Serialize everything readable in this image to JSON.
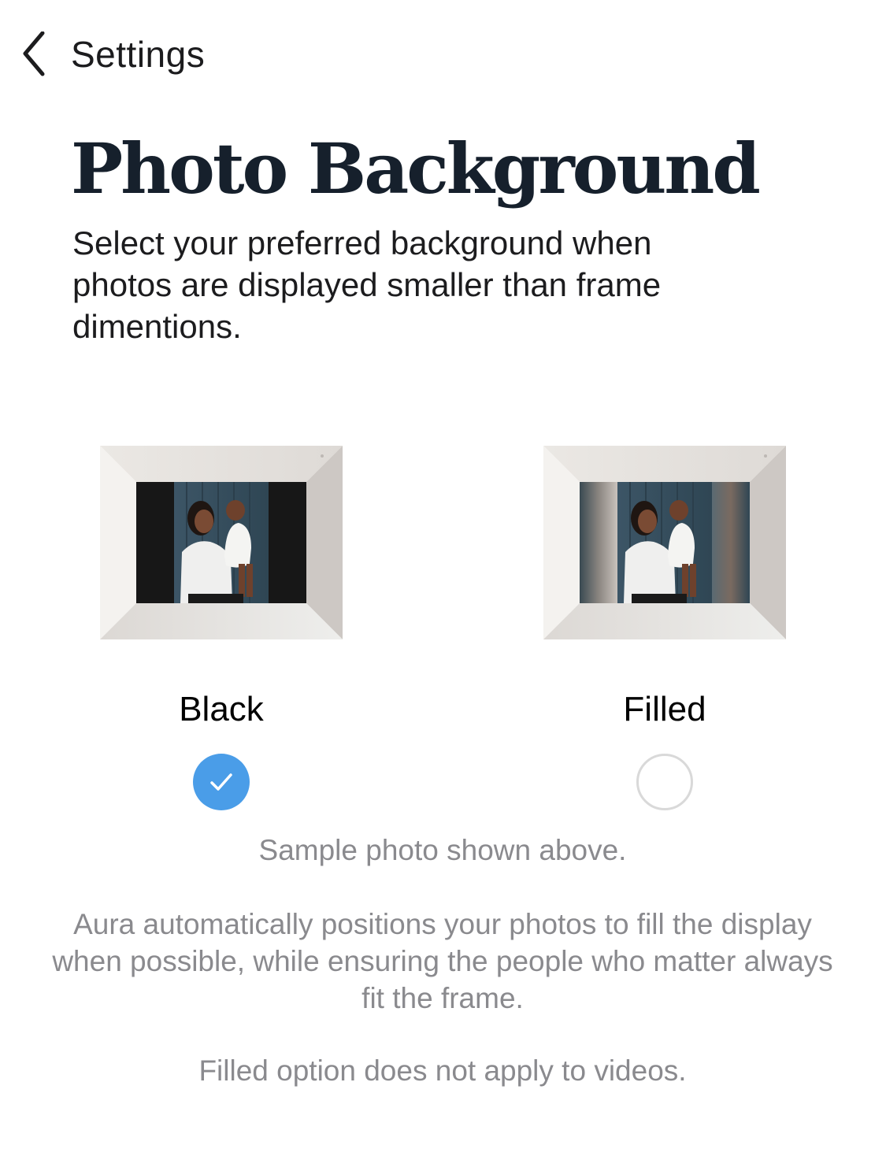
{
  "nav": {
    "back_label": "Settings",
    "back_icon": "chevron-left-icon"
  },
  "header": {
    "title": "Photo Background",
    "subtitle": "Select your preferred background when photos are displayed smaller than frame dimentions."
  },
  "options": [
    {
      "label": "Black",
      "selected": true
    },
    {
      "label": "Filled",
      "selected": false
    }
  ],
  "notes": {
    "sample": "Sample photo shown above.",
    "description": "Aura automatically positions your photos to fill the display when possible, while ensuring the people who matter always fit the frame.",
    "videos": "Filled option does not apply to videos."
  },
  "colors": {
    "accent": "#4a9de8",
    "muted_text": "#8a8a8e",
    "title": "#16202c"
  }
}
